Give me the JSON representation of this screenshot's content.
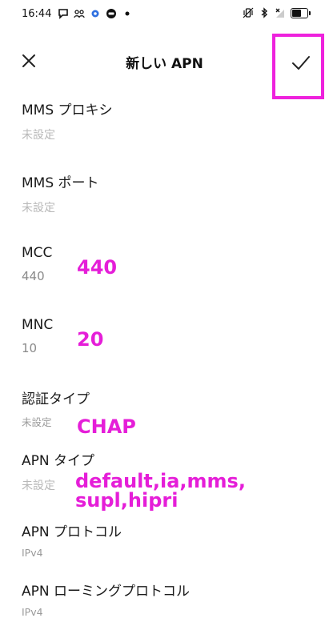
{
  "status_bar": {
    "time": "16:44",
    "left_icons": [
      "message-icon",
      "people-icon",
      "gear-icon",
      "line-app-icon",
      "dot-icon"
    ],
    "right_icons": [
      "vibrate-icon",
      "bluetooth-icon",
      "no-signal-icon",
      "battery-icon"
    ]
  },
  "app_bar": {
    "title": "新しい APN",
    "close_icon": "close-icon",
    "save_icon": "check-icon",
    "highlight_color": "#ee22dd"
  },
  "fields": [
    {
      "label": "MMS プロキシ",
      "value": "未設定"
    },
    {
      "label": "MMS ポート",
      "value": "未設定"
    },
    {
      "label": "MCC",
      "value": "440"
    },
    {
      "label": "MNC",
      "value": "10"
    },
    {
      "label": "認証タイプ",
      "value": "未設定"
    },
    {
      "label": "APN タイプ",
      "value": "未設定"
    },
    {
      "label": "APN プロトコル",
      "value": "IPv4"
    },
    {
      "label": "APN ローミングプロトコル",
      "value": "IPv4"
    }
  ],
  "annotations": {
    "mcc": "440",
    "mnc": "20",
    "auth": "CHAP",
    "apn_type_line1": "default,ia,mms,",
    "apn_type_line2": "supl,hipri",
    "color": "#e51ed8"
  }
}
